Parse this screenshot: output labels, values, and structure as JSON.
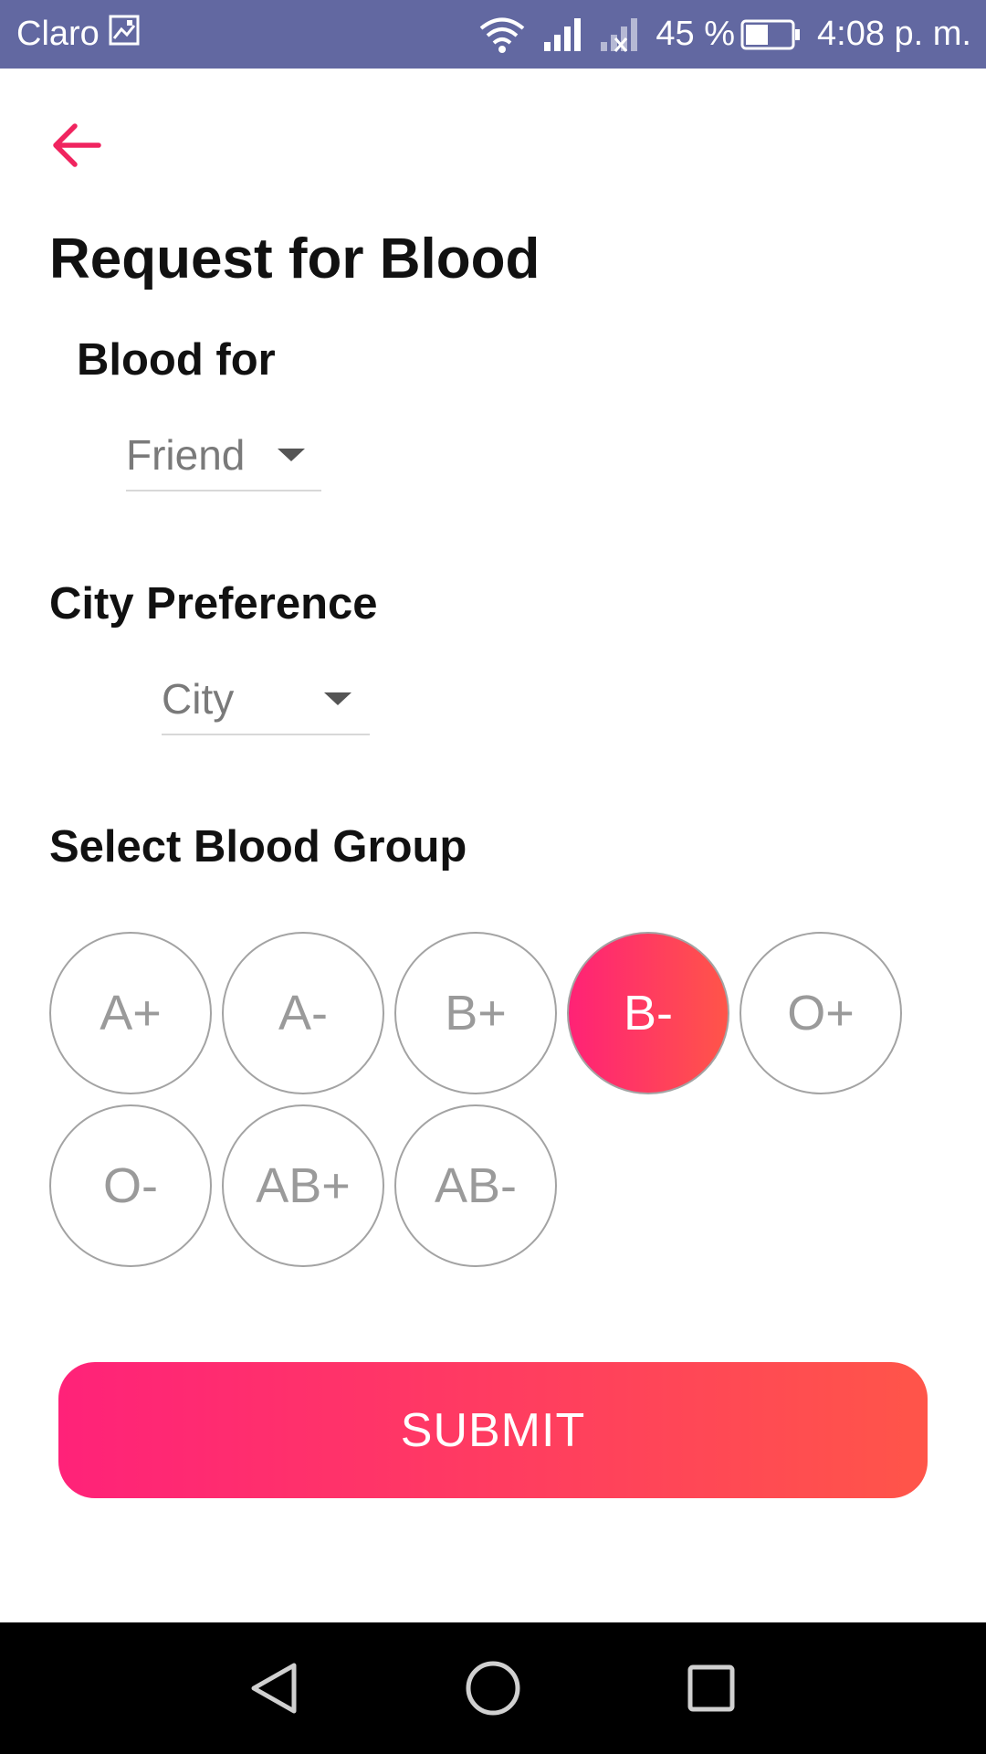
{
  "status_bar": {
    "carrier": "Claro",
    "battery": "45 %",
    "time": "4:08 p. m.",
    "background_color": "#6268a1",
    "icons": [
      "image-icon",
      "wifi-icon",
      "signal-icon",
      "no-signal-icon",
      "battery-icon"
    ]
  },
  "header": {
    "back_icon": "arrow-left-icon",
    "title": "Request for Blood",
    "accent_color": "#f0245f"
  },
  "blood_for": {
    "label": "Blood for",
    "selected": "Friend"
  },
  "city": {
    "label": "City Preference",
    "selected": "City"
  },
  "blood_group": {
    "label": "Select Blood Group",
    "options": [
      "A+",
      "A-",
      "B+",
      "B-",
      "O+",
      "O-",
      "AB+",
      "AB-"
    ],
    "selected": "B-"
  },
  "submit": {
    "label": "SUBMIT",
    "gradient": [
      "#ff2279",
      "#ff5549"
    ]
  },
  "nav_bar": {
    "icons": [
      "back-triangle-icon",
      "home-circle-icon",
      "recents-square-icon"
    ]
  }
}
